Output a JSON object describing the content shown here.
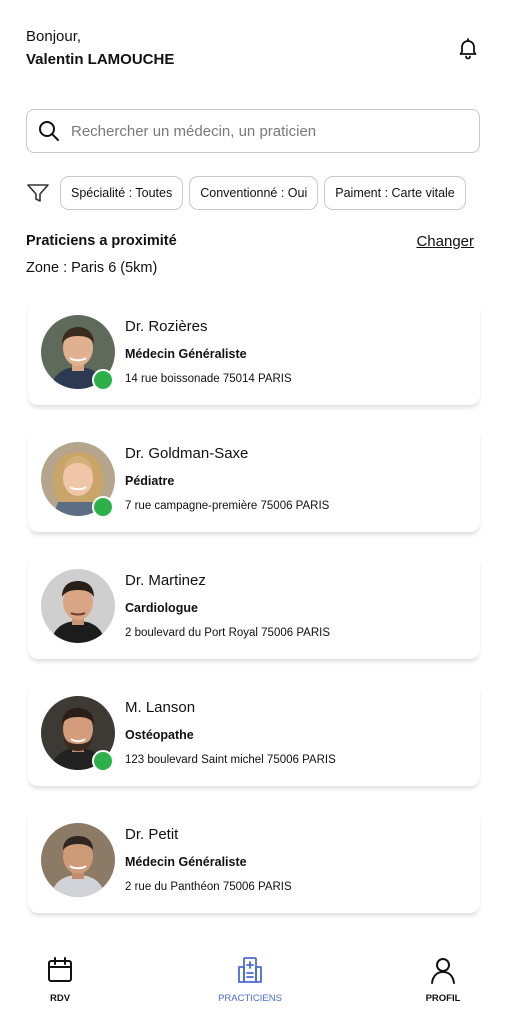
{
  "header": {
    "greeting": "Bonjour,",
    "user_name": "Valentin LAMOUCHE"
  },
  "search": {
    "placeholder": "Rechercher un médecin, un praticien"
  },
  "filters": {
    "chips": [
      "Spécialité : Toutes",
      "Conventionné : Oui",
      "Paiment : Carte vitale"
    ]
  },
  "section": {
    "title": "Praticiens a proximité",
    "change_label": "Changer",
    "zone": "Zone : Paris 6 (5km)"
  },
  "practitioners": [
    {
      "name": "Dr. Rozières",
      "specialty": "Médecin Généraliste",
      "address": "14 rue boissonade 75014 PARIS",
      "online": true
    },
    {
      "name": "Dr. Goldman-Saxe",
      "specialty": "Pédiatre",
      "address": "7 rue campagne-première 75006 PARIS",
      "online": true
    },
    {
      "name": "Dr. Martinez",
      "specialty": "Cardiologue",
      "address": "2 boulevard du Port Royal 75006 PARIS",
      "online": false
    },
    {
      "name": "M. Lanson",
      "specialty": "Ostéopathe",
      "address": "123 boulevard Saint michel 75006 PARIS",
      "online": true
    },
    {
      "name": "Dr. Petit",
      "specialty": "Médecin Généraliste",
      "address": "2 rue du Panthéon 75006 PARIS",
      "online": false
    }
  ],
  "nav": {
    "rdv": "RDV",
    "practiciens": "PRACTICIENS",
    "profil": "PROFIL",
    "active": "practiciens"
  },
  "colors": {
    "accent": "#4a6bd6",
    "online": "#2db04a",
    "border": "#c9c9c9"
  },
  "icons": [
    "bell-icon",
    "search-icon",
    "filter-icon",
    "calendar-icon",
    "hospital-icon",
    "user-icon"
  ]
}
